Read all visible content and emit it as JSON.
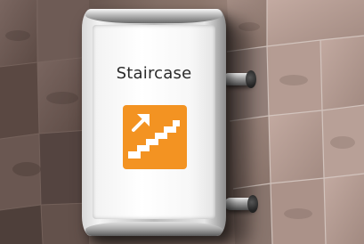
{
  "sign": {
    "label": "Staircase",
    "pictogram": "staircase-up-arrow-icon",
    "pictogram_color": "#f39322"
  },
  "colors": {
    "wall": "#8c766c",
    "frame": "#c8c8c8"
  }
}
